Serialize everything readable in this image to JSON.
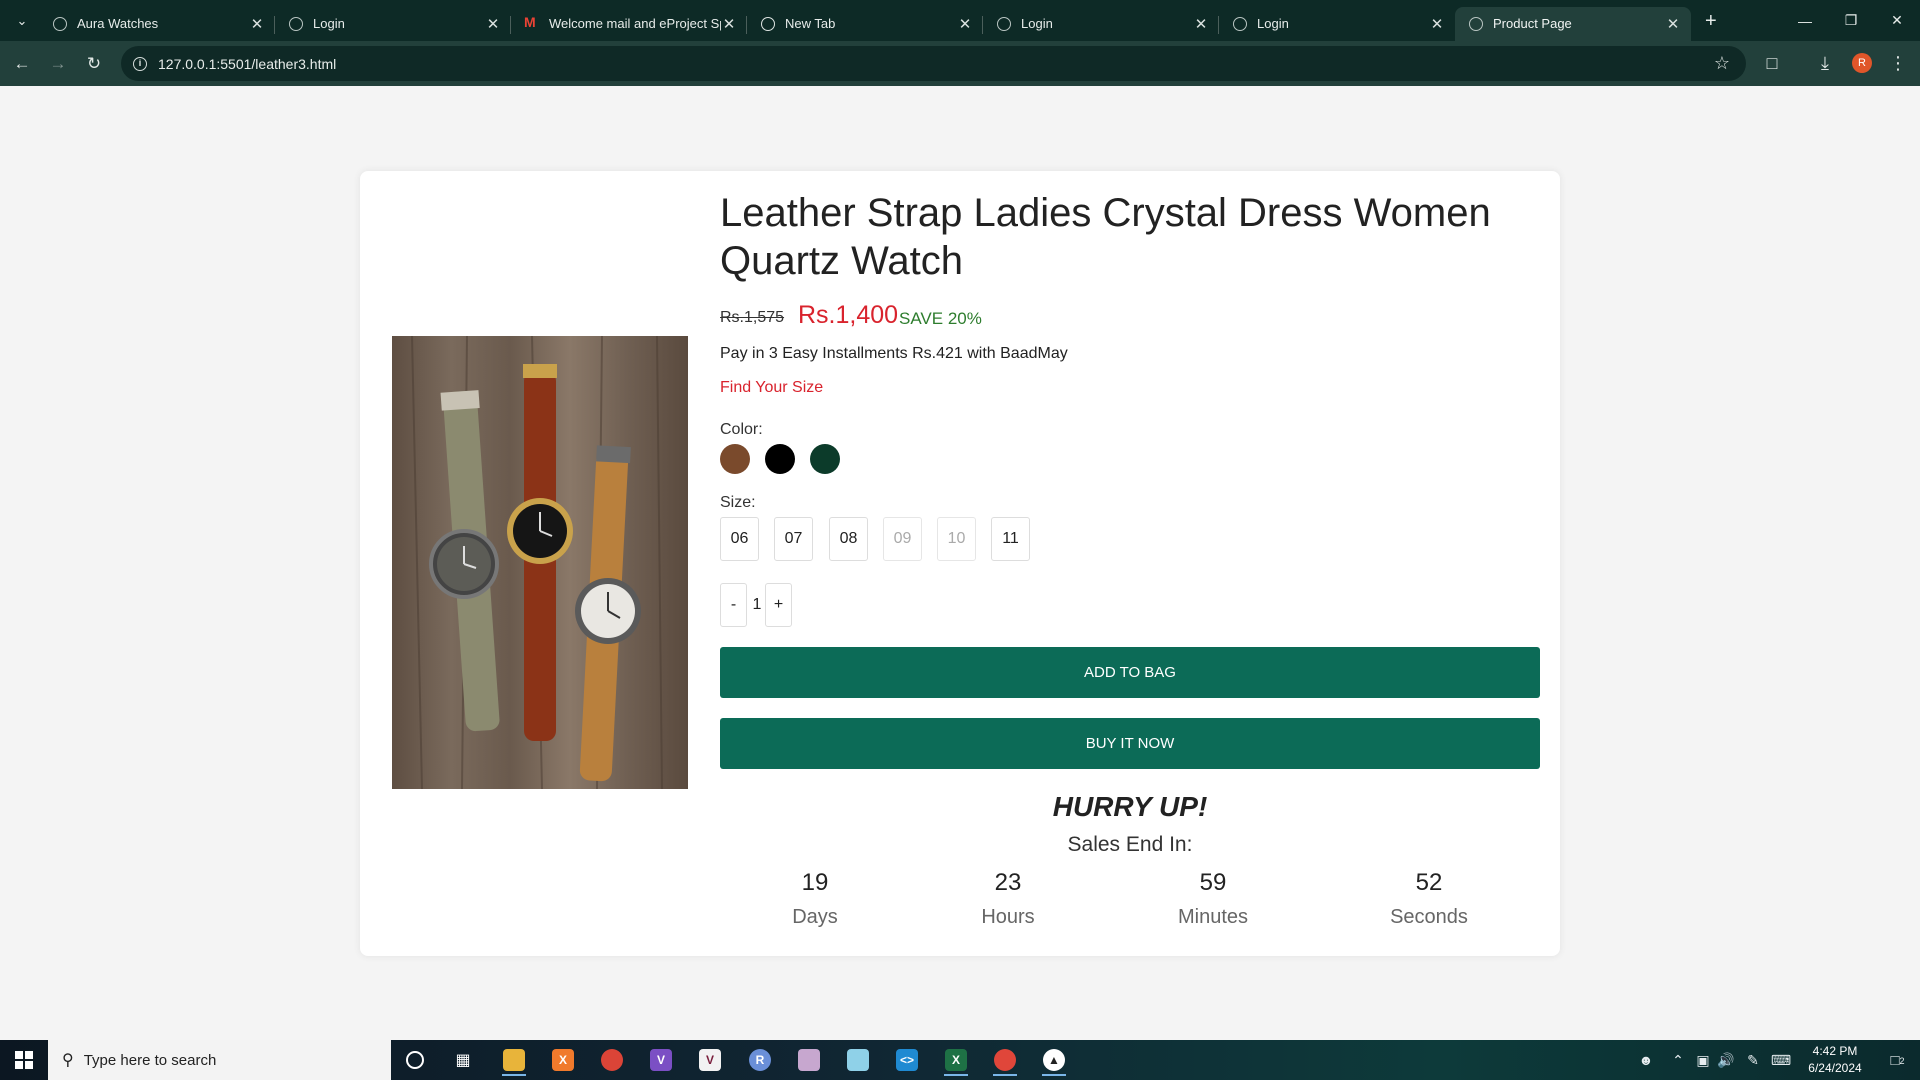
{
  "browser": {
    "tabs": [
      {
        "title": "Aura Watches",
        "icon": "globe-icon"
      },
      {
        "title": "Login",
        "icon": "globe-icon"
      },
      {
        "title": "Welcome mail and eProject Sp",
        "icon": "gmail-icon"
      },
      {
        "title": "New Tab",
        "icon": "chrome-icon"
      },
      {
        "title": "Login",
        "icon": "globe-icon"
      },
      {
        "title": "Login",
        "icon": "globe-icon"
      },
      {
        "title": "Product Page",
        "icon": "globe-icon",
        "active": true
      }
    ],
    "url": "127.0.0.1:5501/leather3.html",
    "profile_initial": "R"
  },
  "product": {
    "title": "Leather Strap Ladies Crystal Dress Women Quartz Watch",
    "old_price": "Rs.1,575",
    "new_price": "Rs.1,400",
    "save": "SAVE 20%",
    "installments": "Pay in 3 Easy Installments Rs.421 with BaadMay",
    "find_size": "Find Your Size",
    "color_label": "Color:",
    "colors": [
      "#7a4a2c",
      "#000000",
      "#0c3b2a"
    ],
    "size_label": "Size:",
    "sizes": [
      {
        "label": "06",
        "available": true
      },
      {
        "label": "07",
        "available": true
      },
      {
        "label": "08",
        "available": true
      },
      {
        "label": "09",
        "available": false
      },
      {
        "label": "10",
        "available": false
      },
      {
        "label": "11",
        "available": true
      }
    ],
    "quantity": {
      "minus": "-",
      "value": "1",
      "plus": "+"
    },
    "add_to_bag": "ADD TO BAG",
    "buy_now": "BUY IT NOW",
    "accent_color": "#0c6b57",
    "price_color": "#d9232d"
  },
  "countdown": {
    "hurry": "HURRY UP!",
    "sales_end": "Sales End In:",
    "units": [
      {
        "value": "19",
        "label": "Days"
      },
      {
        "value": "23",
        "label": "Hours"
      },
      {
        "value": "59",
        "label": "Minutes"
      },
      {
        "value": "52",
        "label": "Seconds"
      }
    ]
  },
  "taskbar": {
    "search_placeholder": "Type here to search",
    "time": "4:42 PM",
    "date": "6/24/2024",
    "notification_count": "2"
  }
}
